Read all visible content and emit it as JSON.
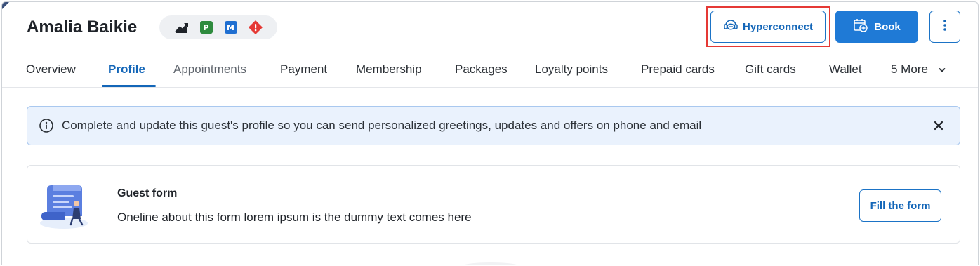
{
  "guest": {
    "name": "Amalia Baikie",
    "badges": [
      {
        "icon": "trend-chart-icon"
      },
      {
        "icon": "p-badge-icon",
        "label": "P",
        "color": "#2e8b3e"
      },
      {
        "icon": "m-badge-icon",
        "label": "M",
        "color": "#1f6fd1"
      },
      {
        "icon": "alert-diamond-icon",
        "label": "!",
        "color": "#e53935"
      }
    ]
  },
  "actions": {
    "hyperconnect_label": "Hyperconnect",
    "book_label": "Book",
    "more_icon": "more-vertical-icon"
  },
  "tabs": [
    {
      "label": "Overview"
    },
    {
      "label": "Profile",
      "active": true
    },
    {
      "label": "Appointments"
    },
    {
      "label": "Payment"
    },
    {
      "label": "Membership"
    },
    {
      "label": "Packages"
    },
    {
      "label": "Loyalty points"
    },
    {
      "label": "Prepaid cards"
    },
    {
      "label": "Gift cards"
    },
    {
      "label": "Wallet"
    },
    {
      "label": "5 More"
    }
  ],
  "banner": {
    "text": "Complete and update this guest's profile so you can send personalized greetings, updates and offers on phone and email"
  },
  "form_card": {
    "title": "Guest form",
    "description": "Oneline about this form lorem ipsum is the dummy text comes here",
    "button_label": "Fill the form"
  },
  "colors": {
    "primary": "#1f7ad6",
    "link": "#1366b8",
    "banner_bg": "#eaf2fd",
    "highlight": "#e53935"
  }
}
